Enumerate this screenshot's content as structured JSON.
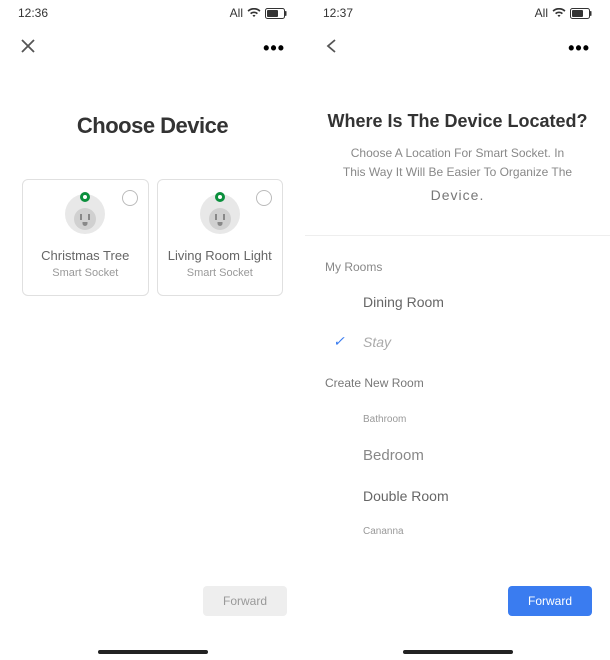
{
  "screen1": {
    "status": {
      "time": "12:36",
      "network": "All"
    },
    "title": "Choose Device",
    "devices": [
      {
        "name": "Christmas Tree",
        "type": "Smart Socket"
      },
      {
        "name": "Living Room Light",
        "type": "Smart Socket"
      }
    ],
    "forward_label": "Forward"
  },
  "screen2": {
    "status": {
      "time": "12:37",
      "network": "All"
    },
    "title": "Where Is The Device Located?",
    "subtitle_line1": "Choose A Location For Smart Socket. In",
    "subtitle_line2": "This Way It Will Be Easier To Organize The",
    "subtitle_line3": "Device.",
    "my_rooms_label": "My Rooms",
    "rooms": [
      {
        "label": "Dining Room",
        "selected": false
      },
      {
        "label": "Stay",
        "selected": true
      }
    ],
    "create_room_label": "Create New Room",
    "new_rooms": [
      {
        "label": "Bathroom"
      },
      {
        "label": "Bedroom"
      },
      {
        "label": "Double Room"
      },
      {
        "label": "Cananna"
      }
    ],
    "forward_label": "Forward"
  }
}
